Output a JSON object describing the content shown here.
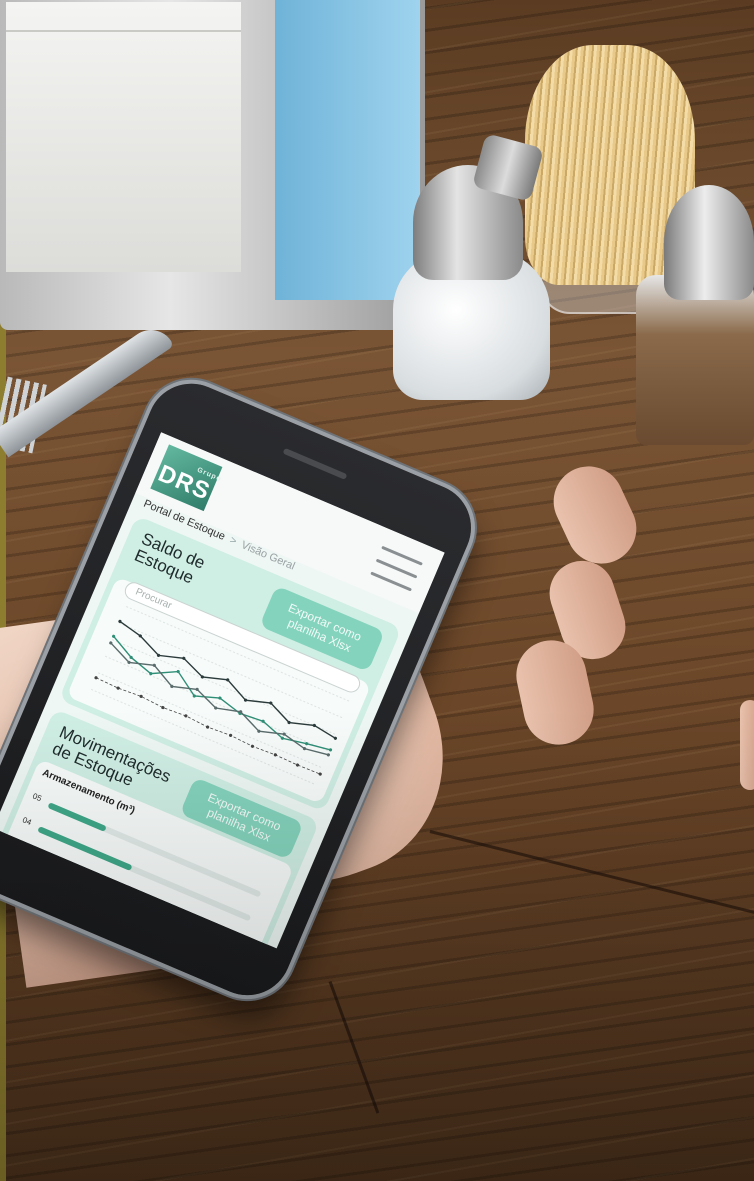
{
  "app": {
    "logo_top": "Grupo",
    "logo_text": "DRS",
    "breadcrumb": {
      "root": "Portal de Estoque",
      "separator": ">",
      "current": "Visão Geral"
    }
  },
  "stock_card": {
    "title": "Saldo de Estoque",
    "export_label": "Exportar como planilha Xlsx",
    "search_placeholder": "Procurar"
  },
  "movement_card": {
    "title": "Movimentações de Estoque",
    "export_label": "Exportar como planilha Xlsx",
    "storage_label": "Armazenamento (m³)",
    "bars": [
      {
        "label": "05",
        "percent": 0.27
      },
      {
        "label": "04",
        "percent": 0.44
      }
    ]
  },
  "chart_data": {
    "type": "line",
    "x": [
      1,
      2,
      3,
      4,
      5,
      6,
      7,
      8,
      9,
      10,
      11
    ],
    "series": [
      {
        "values": [
          820,
          760,
          640,
          720,
          610,
          690,
          560,
          640,
          520,
          600,
          560
        ],
        "color": "#2b3a3a"
      },
      {
        "values": [
          640,
          500,
          420,
          560,
          380,
          470,
          400,
          420,
          330,
          380,
          420
        ],
        "color": "#2f8f76"
      },
      {
        "values": [
          560,
          440,
          520,
          380,
          460,
          350,
          420,
          300,
          380,
          320,
          360
        ],
        "color": "#5a6b6b"
      },
      {
        "values": [
          140,
          130,
          145,
          125,
          140,
          120,
          135,
          118,
          130,
          122,
          128
        ],
        "color": "#444"
      }
    ],
    "ylim": [
      0,
      1000
    ],
    "grid": true,
    "colors": {
      "accent": "#84d3bc",
      "card": "#cfeee4"
    }
  }
}
